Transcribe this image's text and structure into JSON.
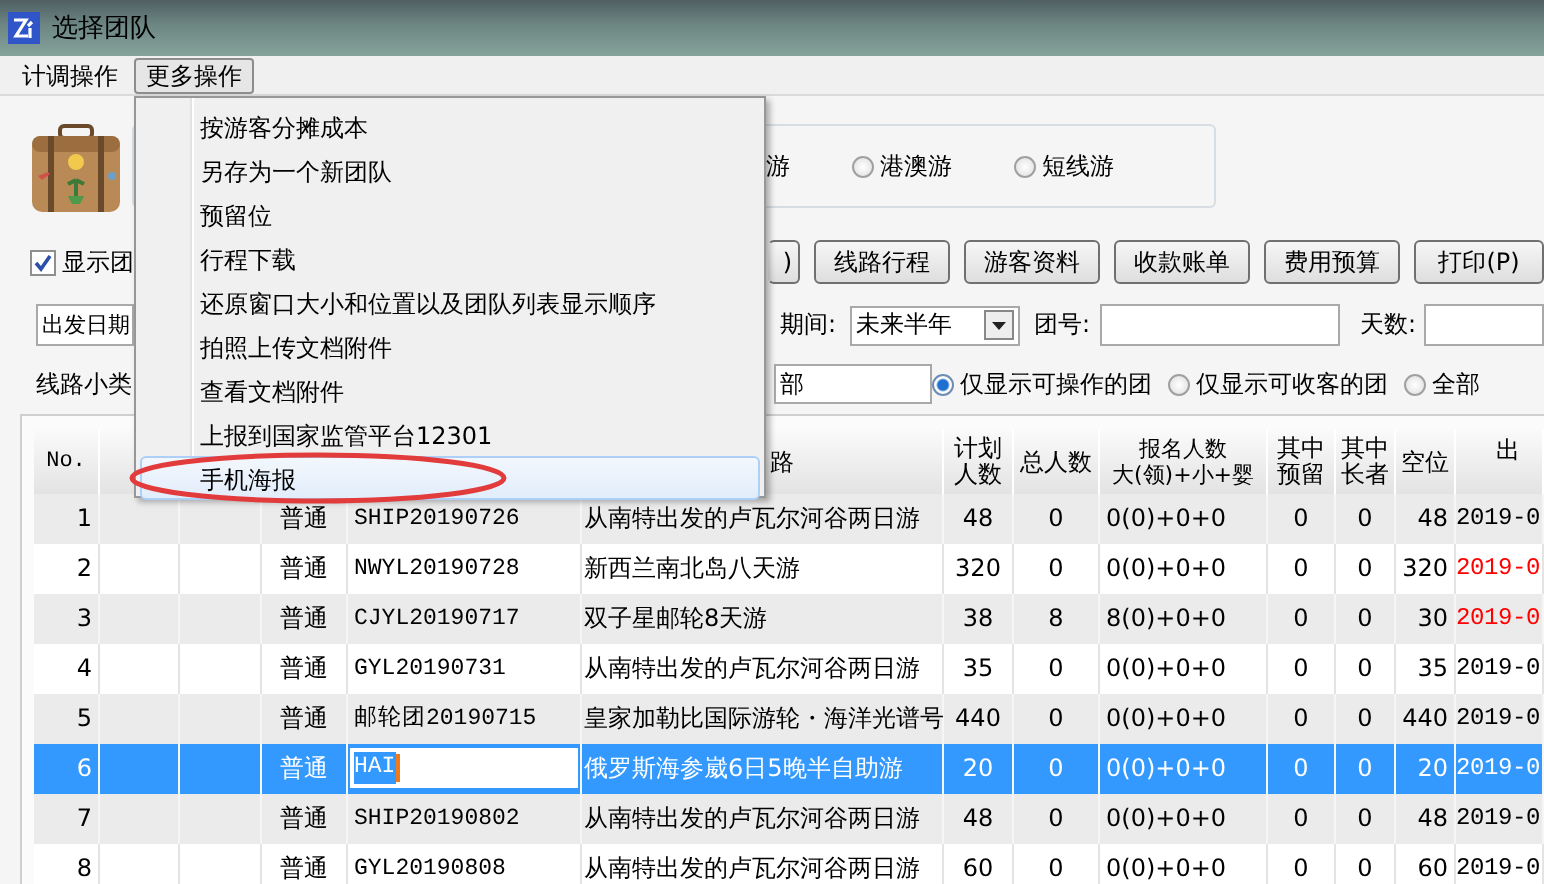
{
  "window": {
    "title": "选择团队"
  },
  "menubar": [
    {
      "label": "计调操作",
      "open": false
    },
    {
      "label": "更多操作",
      "open": true
    }
  ],
  "menu": {
    "items": [
      {
        "label": "按游客分摊成本",
        "highlighted": false
      },
      {
        "label": "另存为一个新团队",
        "highlighted": false
      },
      {
        "label": "预留位",
        "highlighted": false
      },
      {
        "label": "行程下载",
        "highlighted": false
      },
      {
        "label": "还原窗口大小和位置以及团队列表显示顺序",
        "highlighted": false
      },
      {
        "label": "拍照上传文档附件",
        "highlighted": false
      },
      {
        "label": "查看文档附件",
        "highlighted": false
      },
      {
        "label": "上报到国家监管平台12301",
        "highlighted": false
      },
      {
        "label": "手机海报",
        "highlighted": true
      }
    ]
  },
  "tour_types": {
    "fragment": "游",
    "options": [
      {
        "label": "港澳游",
        "selected": false
      },
      {
        "label": "短线游",
        "selected": false
      }
    ]
  },
  "show_groups": {
    "label": "显示团",
    "checked": true
  },
  "buttons": [
    ")",
    "线路行程",
    "游客资料",
    "收款账单",
    "费用预算",
    "打印(P)"
  ],
  "date_field": {
    "value": "出发日期"
  },
  "period": {
    "label": "期间:",
    "value": "未来半年"
  },
  "group_no": {
    "label": "团号:"
  },
  "days": {
    "label": "天数:"
  },
  "subcategory": {
    "label": "线路小类",
    "value": "部"
  },
  "filters": [
    {
      "label": "仅显示可操作的团",
      "selected": true
    },
    {
      "label": "仅显示可收客的团",
      "selected": false
    },
    {
      "label": "全部",
      "selected": false
    }
  ],
  "table": {
    "columns": [
      {
        "lines": [
          "No."
        ]
      },
      {
        "lines": [
          "路"
        ]
      },
      {
        "lines": [
          "计划",
          "人数"
        ]
      },
      {
        "lines": [
          "总人数"
        ]
      },
      {
        "lines": [
          "报名人数",
          "大(领)+小+婴"
        ]
      },
      {
        "lines": [
          "其中",
          "预留"
        ]
      },
      {
        "lines": [
          "其中",
          "长者"
        ]
      },
      {
        "lines": [
          "空位"
        ]
      },
      {
        "lines": [
          "出"
        ]
      }
    ],
    "rows": [
      {
        "no": "1",
        "type": "普通",
        "code": "SHIP20190726",
        "route": "从南特出发的卢瓦尔河谷两日游",
        "plan": "48",
        "total": "0",
        "signup": "0(0)+0+0",
        "reserved": "0",
        "elderly": "0",
        "vacant": "48",
        "date": {
          "text": "2019-0",
          "color": "#000000"
        },
        "selected": false,
        "editing": false
      },
      {
        "no": "2",
        "type": "普通",
        "code": "NWYL20190728",
        "route": "新西兰南北岛八天游",
        "plan": "320",
        "total": "0",
        "signup": "0(0)+0+0",
        "reserved": "0",
        "elderly": "0",
        "vacant": "320",
        "date": {
          "text": "2019-0",
          "color": "#ff0000"
        },
        "selected": false,
        "editing": false
      },
      {
        "no": "3",
        "type": "普通",
        "code": "CJYL20190717",
        "route": "双子星邮轮8天游",
        "plan": "38",
        "total": "8",
        "signup": "8(0)+0+0",
        "reserved": "0",
        "elderly": "0",
        "vacant": "30",
        "date": {
          "text": "2019-0",
          "color": "#ff0000"
        },
        "selected": false,
        "editing": false
      },
      {
        "no": "4",
        "type": "普通",
        "code": "GYL20190731",
        "route": "从南特出发的卢瓦尔河谷两日游",
        "plan": "35",
        "total": "0",
        "signup": "0(0)+0+0",
        "reserved": "0",
        "elderly": "0",
        "vacant": "35",
        "date": {
          "text": "2019-0",
          "color": "#000000"
        },
        "selected": false,
        "editing": false
      },
      {
        "no": "5",
        "type": "普通",
        "code": "邮轮团20190715",
        "route": "皇家加勒比国际游轮・海洋光谱号",
        "plan": "440",
        "total": "0",
        "signup": "0(0)+0+0",
        "reserved": "0",
        "elderly": "0",
        "vacant": "440",
        "date": {
          "text": "2019-0",
          "color": "#000000"
        },
        "selected": false,
        "editing": false
      },
      {
        "no": "6",
        "type": "普通",
        "code": "HAI",
        "route": "俄罗斯海参崴6日5晚半自助游",
        "plan": "20",
        "total": "0",
        "signup": "0(0)+0+0",
        "reserved": "0",
        "elderly": "0",
        "vacant": "20",
        "date": {
          "text": "2019-0"
        },
        "selected": true,
        "editing": true
      },
      {
        "no": "7",
        "type": "普通",
        "code": "SHIP20190802",
        "route": "从南特出发的卢瓦尔河谷两日游",
        "plan": "48",
        "total": "0",
        "signup": "0(0)+0+0",
        "reserved": "0",
        "elderly": "0",
        "vacant": "48",
        "date": {
          "text": "2019-0",
          "color": "#000000"
        },
        "selected": false,
        "editing": false
      },
      {
        "no": "8",
        "type": "普通",
        "code": "GYL20190808",
        "route": "从南特出发的卢瓦尔河谷两日游",
        "plan": "60",
        "total": "0",
        "signup": "0(0)+0+0",
        "reserved": "0",
        "elderly": "0",
        "vacant": "60",
        "date": {
          "text": "2019-0",
          "color": "#000000"
        },
        "selected": false,
        "editing": false
      }
    ]
  }
}
